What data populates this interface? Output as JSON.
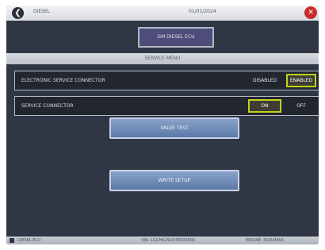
{
  "topbar": {
    "back_icon": "back-arrow-icon",
    "label": "DIESEL",
    "date": "01/01/2024",
    "close_icon": "close-x-icon"
  },
  "title_plate": {
    "label": "GM DIESEL ECU"
  },
  "subtitle": "SERVICE MENU",
  "rows": [
    {
      "label": "ELECTRONIC SERVICE CONNECTOR",
      "options": [
        "DISABLED",
        "ENABLED"
      ],
      "selected": "ENABLED"
    },
    {
      "label": "SERVICE CONNECTOR",
      "options": [
        "ON",
        "OFF"
      ],
      "selected": "ON"
    }
  ],
  "buttons": {
    "first": "VALVE TEST",
    "second": "WRITE SETUP"
  },
  "bottombar": {
    "left": "DIESEL ECU",
    "middle": "VIN: 1GCHK29U97E000000",
    "right": "ENGINE: DURAMAX"
  },
  "colors": {
    "background": "#303744",
    "row_background": "#22272f",
    "selected_outline": "#c2d21b",
    "button_fill": "#6f8dbb",
    "title_plate": "#4e4c78",
    "close_red": "#c62c2c"
  }
}
